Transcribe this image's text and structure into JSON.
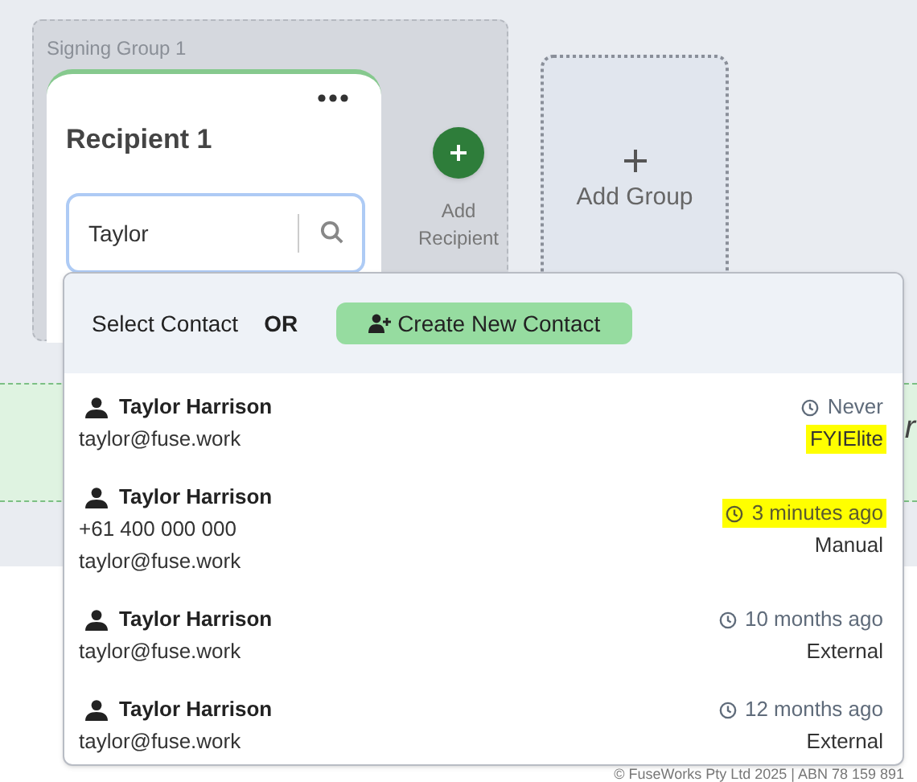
{
  "signing_group": {
    "title": "Signing Group 1",
    "recipient": {
      "title": "Recipient 1",
      "search": {
        "value": "Taylor"
      }
    },
    "add_recipient": "Add Recipient"
  },
  "add_group": {
    "label": "Add Group"
  },
  "band_text": "r",
  "footer": "© FuseWorks Pty Ltd 2025 | ABN 78 159 891",
  "contact_popup": {
    "prompt": "Select Contact",
    "or": "OR",
    "create_button": "Create New Contact",
    "contacts": [
      {
        "name": "Taylor Harrison",
        "email": "taylor@fuse.work",
        "last_used": "Never",
        "last_used_highlighted": false,
        "source": "FYIElite",
        "source_highlighted": true
      },
      {
        "name": "Taylor Harrison",
        "phone": "+61 400 000 000",
        "email": "taylor@fuse.work",
        "last_used": "3 minutes ago",
        "last_used_highlighted": true,
        "source": "Manual",
        "source_highlighted": false
      },
      {
        "name": "Taylor Harrison",
        "email": "taylor@fuse.work",
        "last_used": "10 months ago",
        "last_used_highlighted": false,
        "source": "External",
        "source_highlighted": false
      },
      {
        "name": "Taylor Harrison",
        "email": "taylor@fuse.work",
        "last_used": "12 months ago",
        "last_used_highlighted": false,
        "source": "External",
        "source_highlighted": false
      }
    ]
  }
}
